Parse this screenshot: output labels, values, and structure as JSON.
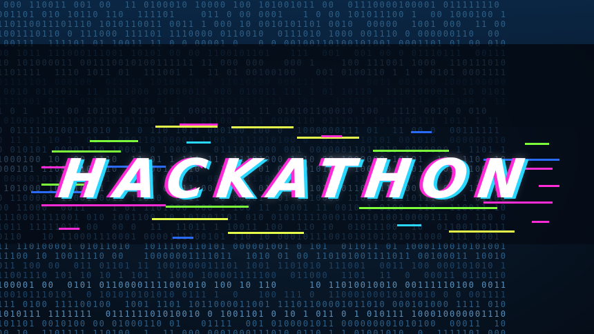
{
  "title": "HACKATHON",
  "colors": {
    "background": "#081626",
    "binary_text": "#2e5f86",
    "title_fill": "#ffffff",
    "glitch_magenta": "#ff2bd6",
    "glitch_cyan": "#2ad8ff",
    "glitch_green": "#7cff3a",
    "glitch_yellow": "#e6ff4a",
    "glitch_blue": "#2a6bff"
  },
  "icons": [
    "binary-code-background",
    "glitch-lines"
  ]
}
